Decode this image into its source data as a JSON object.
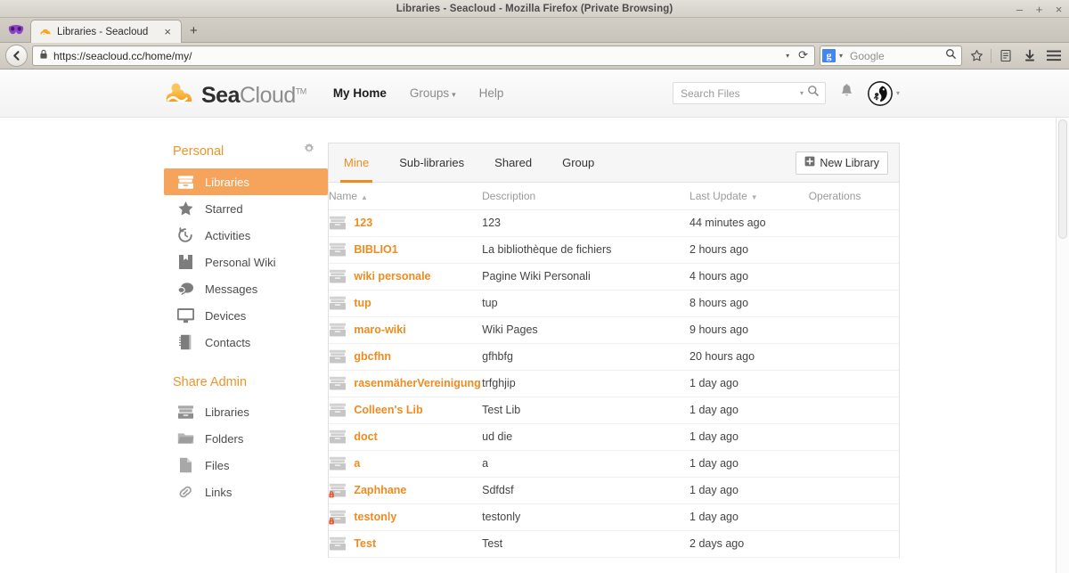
{
  "window": {
    "title": "Libraries - Seacloud - Mozilla Firefox (Private Browsing)",
    "minimize": "–",
    "maximize": "+",
    "close": "×"
  },
  "browser": {
    "private_mask_icon": "mask-icon",
    "tab": {
      "title": "Libraries - Seacloud",
      "close": "×",
      "favicon": "seacloud-favicon"
    },
    "new_tab": "+",
    "back": "back-arrow",
    "url": "https://seacloud.cc/home/my/",
    "url_dropdown": "▾",
    "reload": "⟳",
    "search_engine": "g",
    "search_engine_caret": "▾",
    "search_placeholder": "Google",
    "bookmark_icon": "star-icon",
    "reader_icon": "reader-icon",
    "download_icon": "download-icon",
    "menu_icon": "hamburger-icon"
  },
  "app": {
    "brand": {
      "sea": "Sea",
      "cloud": "Cloud",
      "tm": "TM"
    },
    "nav": [
      {
        "label": "My Home",
        "active": true,
        "caret": ""
      },
      {
        "label": "Groups",
        "active": false,
        "caret": "▾"
      },
      {
        "label": "Help",
        "active": false,
        "caret": ""
      }
    ],
    "search_files_placeholder": "Search Files",
    "search_caret": "▾",
    "notification_icon": "bell-icon",
    "avatar_icon": "user-avatar",
    "avatar_caret": "▾"
  },
  "sidebar": {
    "personal": {
      "title": "Personal",
      "settings_icon": "gear-icon",
      "items": [
        {
          "label": "Libraries",
          "icon": "library-icon",
          "active": true
        },
        {
          "label": "Starred",
          "icon": "star-icon",
          "active": false
        },
        {
          "label": "Activities",
          "icon": "clock-icon",
          "active": false
        },
        {
          "label": "Personal Wiki",
          "icon": "wiki-icon",
          "active": false
        },
        {
          "label": "Messages",
          "icon": "message-icon",
          "active": false
        },
        {
          "label": "Devices",
          "icon": "monitor-icon",
          "active": false
        },
        {
          "label": "Contacts",
          "icon": "contacts-icon",
          "active": false
        }
      ]
    },
    "share_admin": {
      "title": "Share Admin",
      "items": [
        {
          "label": "Libraries",
          "icon": "library-icon",
          "active": false
        },
        {
          "label": "Folders",
          "icon": "folder-icon",
          "active": false
        },
        {
          "label": "Files",
          "icon": "file-icon",
          "active": false
        },
        {
          "label": "Links",
          "icon": "link-icon",
          "active": false
        }
      ]
    }
  },
  "main": {
    "tabs": [
      {
        "label": "Mine",
        "active": true
      },
      {
        "label": "Sub-libraries",
        "active": false
      },
      {
        "label": "Shared",
        "active": false
      },
      {
        "label": "Group",
        "active": false
      }
    ],
    "new_library_button": "New Library",
    "new_library_icon": "plus-box-icon",
    "columns": {
      "name": "Name",
      "name_sort": "▲",
      "description": "Description",
      "last_update": "Last Update",
      "last_update_sort": "▼",
      "operations": "Operations"
    },
    "rows": [
      {
        "name": "123",
        "description": "123",
        "last_update": "44 minutes ago",
        "encrypted": false
      },
      {
        "name": "BIBLIO1",
        "description": "La bibliothèque de fichiers",
        "last_update": "2 hours ago",
        "encrypted": false
      },
      {
        "name": "wiki personale",
        "description": "Pagine Wiki Personali",
        "last_update": "4 hours ago",
        "encrypted": false
      },
      {
        "name": "tup",
        "description": "tup",
        "last_update": "8 hours ago",
        "encrypted": false
      },
      {
        "name": "maro-wiki",
        "description": "Wiki Pages",
        "last_update": "9 hours ago",
        "encrypted": false
      },
      {
        "name": "gbcfhn",
        "description": "gfhbfg",
        "last_update": "20 hours ago",
        "encrypted": false
      },
      {
        "name": "rasenmäherVereinigung",
        "description": "trfghjip",
        "last_update": "1 day ago",
        "encrypted": false
      },
      {
        "name": "Colleen's Lib",
        "description": "Test Lib",
        "last_update": "1 day ago",
        "encrypted": false
      },
      {
        "name": "doct",
        "description": "ud die",
        "last_update": "1 day ago",
        "encrypted": false
      },
      {
        "name": "a",
        "description": "a",
        "last_update": "1 day ago",
        "encrypted": false
      },
      {
        "name": "Zaphhane",
        "description": "Sdfdsf",
        "last_update": "1 day ago",
        "encrypted": true
      },
      {
        "name": "testonly",
        "description": "testonly",
        "last_update": "1 day ago",
        "encrypted": true
      },
      {
        "name": "Test",
        "description": "Test",
        "last_update": "2 days ago",
        "encrypted": false
      }
    ]
  },
  "colors": {
    "accent": "#ef8b1f",
    "accent_soft": "#f6a35c",
    "sidebar_heading": "#f09429",
    "lock_badge": "#e04a22"
  }
}
